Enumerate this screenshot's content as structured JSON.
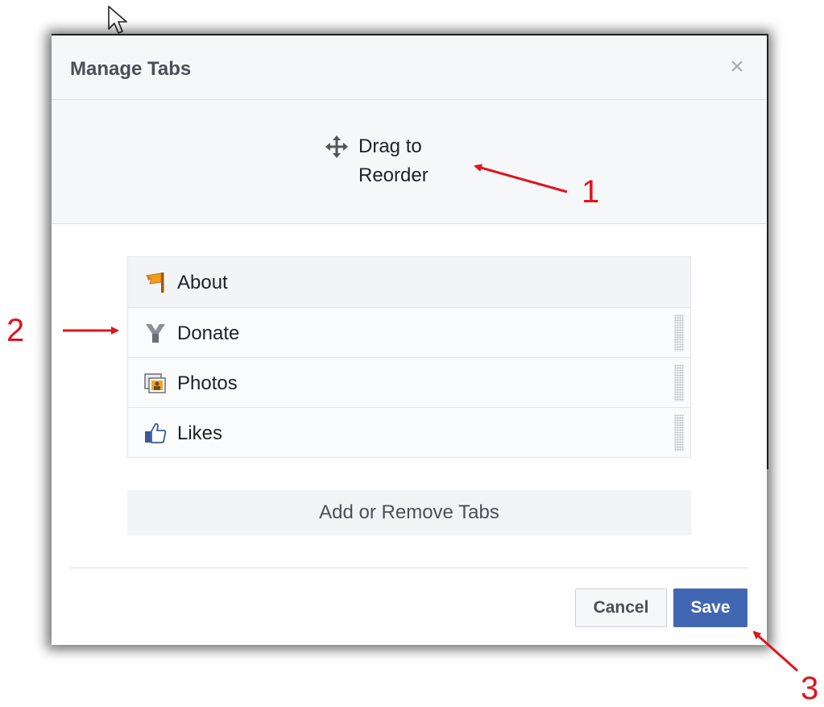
{
  "dialog": {
    "title": "Manage Tabs",
    "close_icon": "close-icon"
  },
  "reorder": {
    "icon": "move-arrows-icon",
    "line1": "Drag to",
    "line2": "Reorder"
  },
  "tabs": [
    {
      "label": "About",
      "icon": "about-flag-icon"
    },
    {
      "label": "Donate",
      "icon": "donate-icon"
    },
    {
      "label": "Photos",
      "icon": "photos-icon"
    },
    {
      "label": "Likes",
      "icon": "likes-thumb-icon"
    }
  ],
  "add_remove_label": "Add or Remove Tabs",
  "footer": {
    "cancel_label": "Cancel",
    "save_label": "Save"
  },
  "annotations": {
    "one": "1",
    "two": "2",
    "three": "3"
  },
  "colors": {
    "save_bg": "#4267b2",
    "annotation_red": "#e0141c",
    "header_bg": "#f6f7f9"
  }
}
